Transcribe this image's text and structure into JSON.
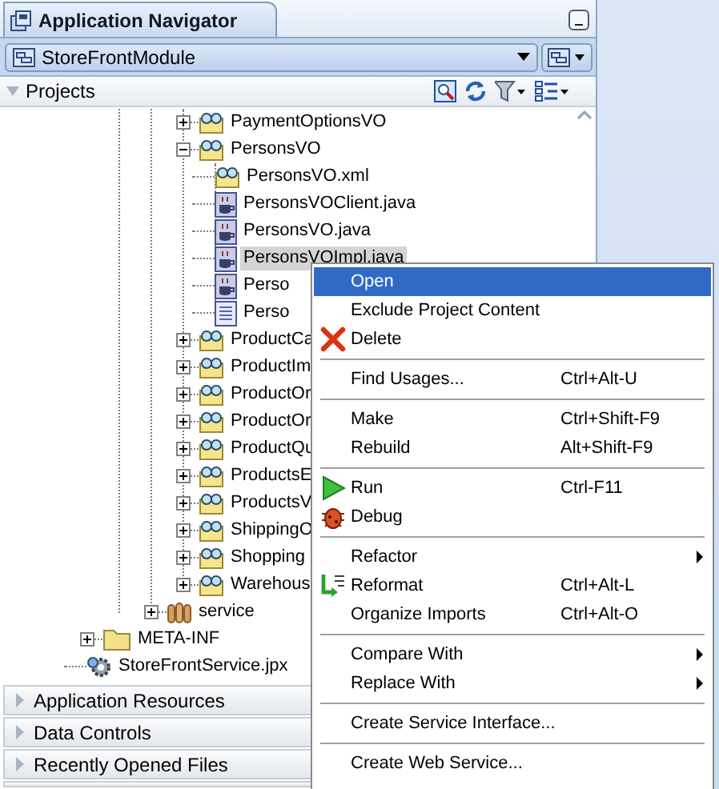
{
  "panel": {
    "title": "Application Navigator"
  },
  "project_selector": {
    "value": "StoreFrontModule"
  },
  "projects_header": {
    "label": "Projects",
    "expanded": true
  },
  "tree": [
    {
      "children": [
        {
          "children": [
            {
              "children": [
                {
                  "label": "PaymentOptionsVO",
                  "kind": "view-object",
                  "expanded": false,
                  "selected": false
                },
                {
                  "label": "PersonsVO",
                  "kind": "view-object",
                  "expanded": true,
                  "selected": false,
                  "children": [
                    {
                      "label": "PersonsVO.xml",
                      "kind": "view-object",
                      "selected": false
                    },
                    {
                      "label": "PersonsVOClient.java",
                      "kind": "java",
                      "selected": false
                    },
                    {
                      "label": "PersonsVO.java",
                      "kind": "java",
                      "selected": false
                    },
                    {
                      "label": "PersonsVOImpl.java",
                      "kind": "java",
                      "selected": true
                    },
                    {
                      "label": "Perso",
                      "kind": "java",
                      "selected": false
                    },
                    {
                      "label": "Perso",
                      "kind": "document",
                      "selected": false
                    }
                  ]
                },
                {
                  "label": "ProductCa",
                  "kind": "view-object",
                  "expanded": false,
                  "selected": false
                },
                {
                  "label": "ProductIm",
                  "kind": "view-object",
                  "expanded": false,
                  "selected": false
                },
                {
                  "label": "ProductOr",
                  "kind": "view-object",
                  "expanded": false,
                  "selected": false
                },
                {
                  "label": "ProductOr",
                  "kind": "view-object",
                  "expanded": false,
                  "selected": false
                },
                {
                  "label": "ProductQu",
                  "kind": "view-object",
                  "expanded": false,
                  "selected": false
                },
                {
                  "label": "ProductsE",
                  "kind": "view-object",
                  "expanded": false,
                  "selected": false
                },
                {
                  "label": "ProductsV",
                  "kind": "view-object",
                  "expanded": false,
                  "selected": false
                },
                {
                  "label": "ShippingO",
                  "kind": "view-object",
                  "expanded": false,
                  "selected": false
                },
                {
                  "label": "Shopping",
                  "kind": "view-object",
                  "expanded": false,
                  "selected": false
                },
                {
                  "label": "Warehous",
                  "kind": "view-object",
                  "expanded": false,
                  "selected": false
                }
              ]
            },
            {
              "label": "service",
              "kind": "package",
              "expanded": false,
              "selected": false
            }
          ]
        }
      ]
    },
    {
      "label": "META-INF",
      "kind": "folder",
      "expanded": false,
      "selected": false
    },
    {
      "label": "StoreFrontService.jpx",
      "kind": "config",
      "selected": false
    }
  ],
  "sections": [
    {
      "label": "Application Resources",
      "expanded": false
    },
    {
      "label": "Data Controls",
      "expanded": false
    },
    {
      "label": "Recently Opened Files",
      "expanded": false
    }
  ],
  "context_menu": {
    "groups": [
      [
        {
          "label": "Open",
          "selected": true,
          "submenu": false
        },
        {
          "label": "Exclude Project Content",
          "selected": false,
          "submenu": false
        },
        {
          "label": "Delete",
          "kind": "delete",
          "selected": false,
          "submenu": false
        }
      ],
      [
        {
          "label": "Find Usages...",
          "shortcut": "Ctrl+Alt-U",
          "selected": false,
          "submenu": false
        }
      ],
      [
        {
          "label": "Make",
          "shortcut": "Ctrl+Shift-F9",
          "selected": false,
          "submenu": false
        },
        {
          "label": "Rebuild",
          "shortcut": "Alt+Shift-F9",
          "selected": false,
          "submenu": false
        }
      ],
      [
        {
          "label": "Run",
          "kind": "run",
          "shortcut": "Ctrl-F11",
          "selected": false,
          "submenu": false
        },
        {
          "label": "Debug",
          "kind": "debug",
          "selected": false,
          "submenu": false
        }
      ],
      [
        {
          "label": "Refactor",
          "selected": false,
          "submenu": true
        },
        {
          "label": "Reformat",
          "kind": "reformat",
          "shortcut": "Ctrl+Alt-L",
          "selected": false,
          "submenu": false
        },
        {
          "label": "Organize Imports",
          "shortcut": "Ctrl+Alt-O",
          "selected": false,
          "submenu": false
        }
      ],
      [
        {
          "label": "Compare With",
          "selected": false,
          "submenu": true
        },
        {
          "label": "Replace With",
          "selected": false,
          "submenu": true
        }
      ],
      [
        {
          "label": "Create Service Interface...",
          "selected": false,
          "submenu": false
        }
      ],
      [
        {
          "label": "Create Web Service...",
          "selected": false,
          "submenu": false
        }
      ]
    ]
  }
}
